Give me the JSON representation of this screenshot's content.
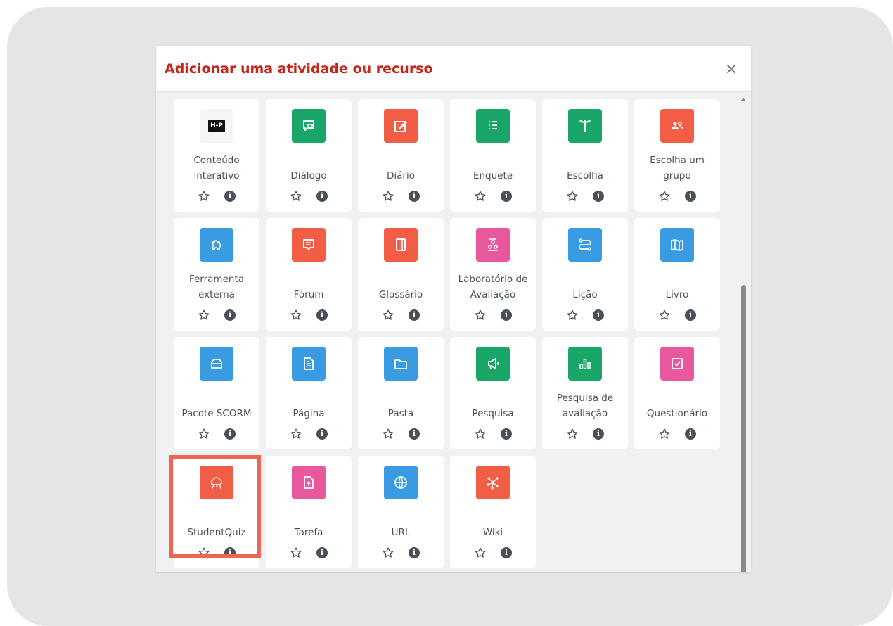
{
  "dialog": {
    "title": "Adicionar uma atividade ou recurso",
    "close_label": "×"
  },
  "activities": [
    {
      "label": "Conteúdo interativo",
      "icon": "h5p-icon",
      "color": "#f5f5f7"
    },
    {
      "label": "Diálogo",
      "icon": "dialogue-icon",
      "color": "#1aa569"
    },
    {
      "label": "Diário",
      "icon": "journal-edit-icon",
      "color": "#f15e45"
    },
    {
      "label": "Enquete",
      "icon": "list-icon",
      "color": "#1aa569"
    },
    {
      "label": "Escolha",
      "icon": "signpost-icon",
      "color": "#1aa569"
    },
    {
      "label": "Escolha um grupo",
      "icon": "group-icon",
      "color": "#f15e45"
    },
    {
      "label": "Ferramenta externa",
      "icon": "puzzle-icon",
      "color": "#399be2"
    },
    {
      "label": "Fórum",
      "icon": "forum-icon",
      "color": "#f15e45"
    },
    {
      "label": "Glossário",
      "icon": "glossary-icon",
      "color": "#f15e45"
    },
    {
      "label": "Laboratório de Avaliação",
      "icon": "workshop-icon",
      "color": "#e8589d"
    },
    {
      "label": "Lição",
      "icon": "lesson-icon",
      "color": "#399be2"
    },
    {
      "label": "Livro",
      "icon": "book-icon",
      "color": "#399be2"
    },
    {
      "label": "Pacote SCORM",
      "icon": "scorm-icon",
      "color": "#399be2"
    },
    {
      "label": "Página",
      "icon": "page-icon",
      "color": "#399be2"
    },
    {
      "label": "Pasta",
      "icon": "folder-icon",
      "color": "#399be2"
    },
    {
      "label": "Pesquisa",
      "icon": "megaphone-icon",
      "color": "#1aa569"
    },
    {
      "label": "Pesquisa de avaliação",
      "icon": "bar-chart-icon",
      "color": "#1aa569"
    },
    {
      "label": "Questionário",
      "icon": "checkbox-icon",
      "color": "#e8589d"
    },
    {
      "label": "StudentQuiz",
      "icon": "brain-icon",
      "color": "#f15e45"
    },
    {
      "label": "Tarefa",
      "icon": "upload-icon",
      "color": "#e8589d"
    },
    {
      "label": "URL",
      "icon": "globe-icon",
      "color": "#399be2"
    },
    {
      "label": "Wiki",
      "icon": "network-icon",
      "color": "#f15e45"
    }
  ],
  "h5p_text": "H-P"
}
